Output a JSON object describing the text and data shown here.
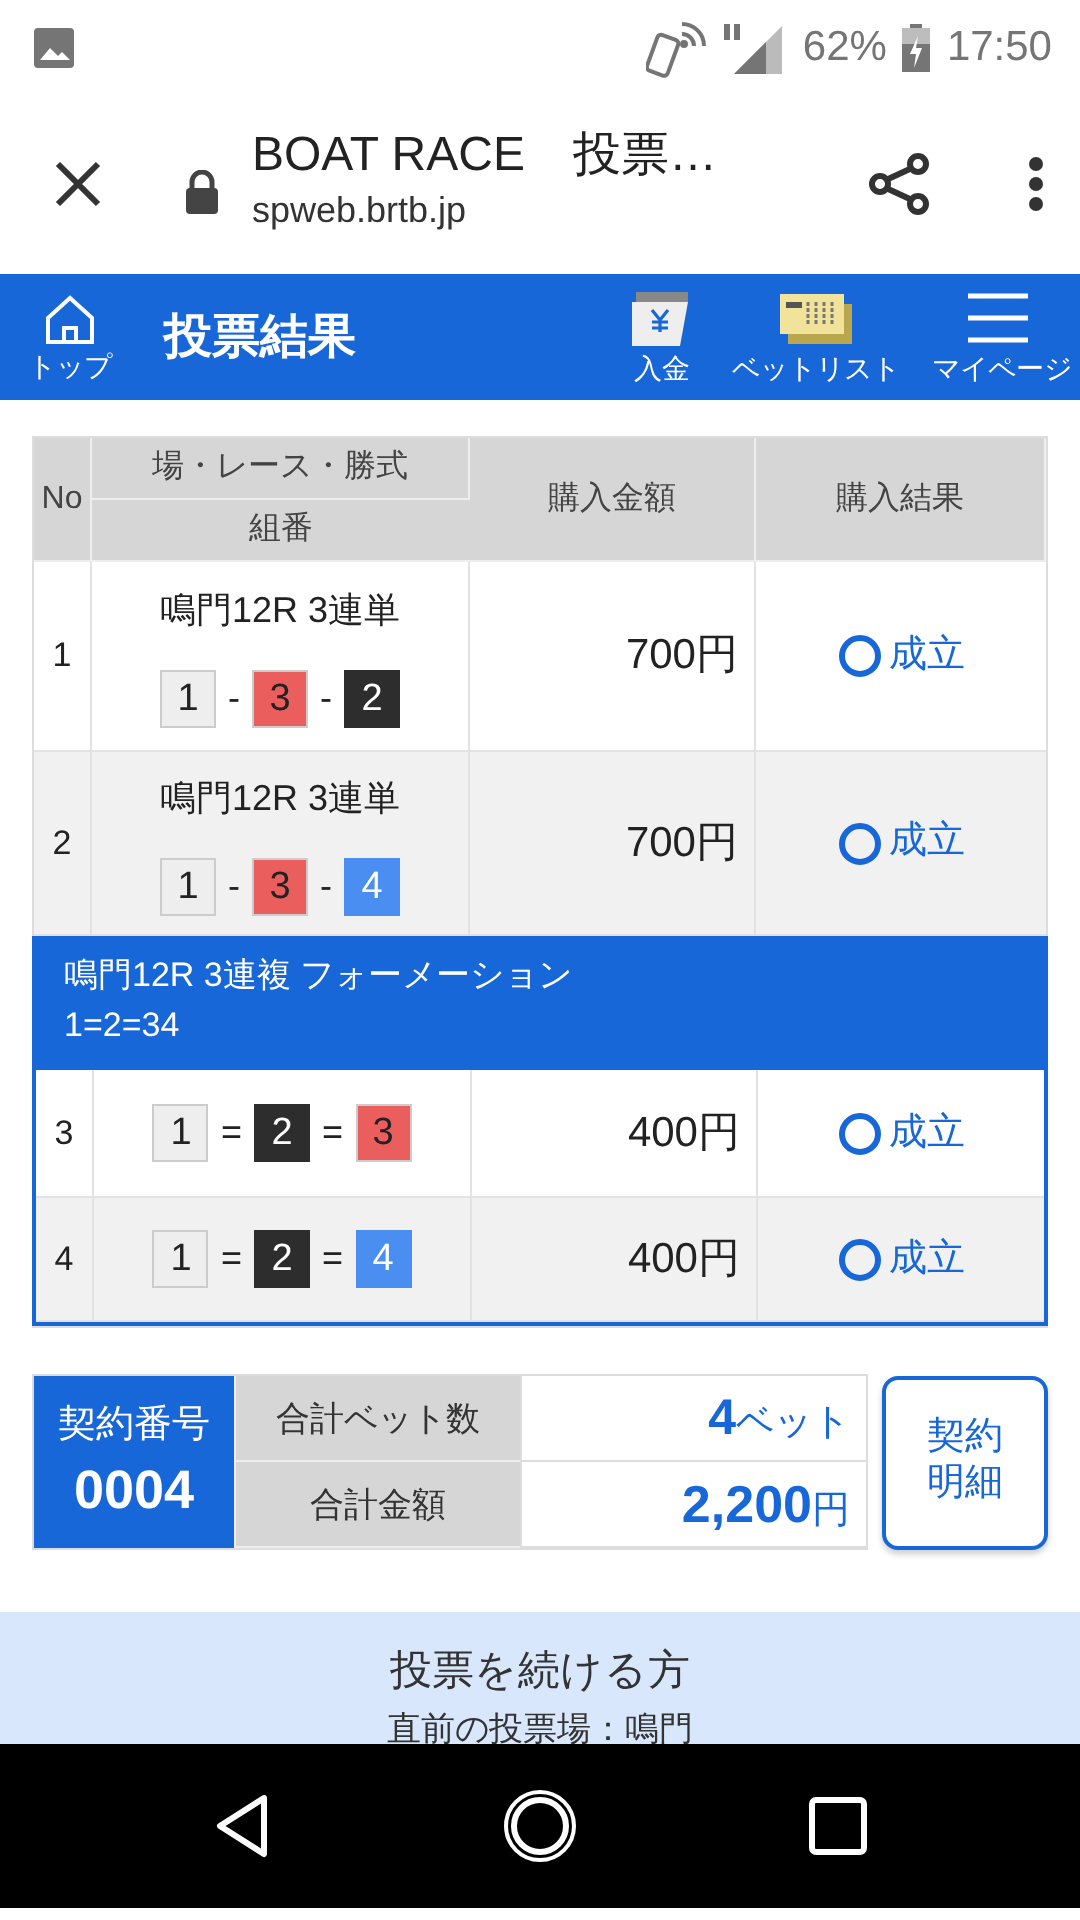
{
  "status_bar": {
    "battery": "62%",
    "time": "17:50"
  },
  "browser": {
    "title": "BOAT RACE　投票…",
    "url": "spweb.brtb.jp"
  },
  "header": {
    "home_label": "トップ",
    "title": "投票結果",
    "actions": [
      "入金",
      "ベットリスト",
      "マイページ"
    ]
  },
  "table": {
    "columns": {
      "no": "No",
      "race": "場・レース・勝式",
      "combo": "組番",
      "amount": "購入金額",
      "result": "購入結果"
    },
    "rows": [
      {
        "kind": "single",
        "no": "1",
        "race": "鳴門12R 3連単",
        "combo": [
          {
            "boat": "1",
            "color": "#eeeeee"
          },
          {
            "sep": "-"
          },
          {
            "boat": "3",
            "color": "#ea5e5e"
          },
          {
            "sep": "-"
          },
          {
            "boat": "2",
            "color": "#2d2d2d"
          }
        ],
        "amount": "700円",
        "result": "成立"
      },
      {
        "kind": "single",
        "no": "2",
        "race": "鳴門12R 3連単",
        "combo": [
          {
            "boat": "1",
            "color": "#eeeeee"
          },
          {
            "sep": "-"
          },
          {
            "boat": "3",
            "color": "#ea5e5e"
          },
          {
            "sep": "-"
          },
          {
            "boat": "4",
            "color": "#4a8ef2"
          }
        ],
        "amount": "700円",
        "result": "成立"
      },
      {
        "kind": "group",
        "title": "鳴門12R 3連複 フォーメーション",
        "subtitle": "1=2=34",
        "rows": [
          {
            "no": "3",
            "combo": [
              {
                "boat": "1",
                "color": "#eeeeee"
              },
              {
                "sep": "="
              },
              {
                "boat": "2",
                "color": "#2d2d2d"
              },
              {
                "sep": "="
              },
              {
                "boat": "3",
                "color": "#ea5e5e"
              }
            ],
            "amount": "400円",
            "result": "成立"
          },
          {
            "no": "4",
            "combo": [
              {
                "boat": "1",
                "color": "#eeeeee"
              },
              {
                "sep": "="
              },
              {
                "boat": "2",
                "color": "#2d2d2d"
              },
              {
                "sep": "="
              },
              {
                "boat": "4",
                "color": "#4a8ef2"
              }
            ],
            "amount": "400円",
            "result": "成立"
          }
        ]
      }
    ]
  },
  "summary": {
    "contract_label": "契約番号",
    "contract_no": "0004",
    "bet_count_label": "合計ベット数",
    "bet_count": "4",
    "bet_unit": "ベット",
    "total_label": "合計金額",
    "total": "2,200",
    "total_unit": "円",
    "details_button": "契約明細"
  },
  "continue_panel": {
    "title": "投票を続ける方",
    "subtitle": "直前の投票場：鳴門"
  }
}
